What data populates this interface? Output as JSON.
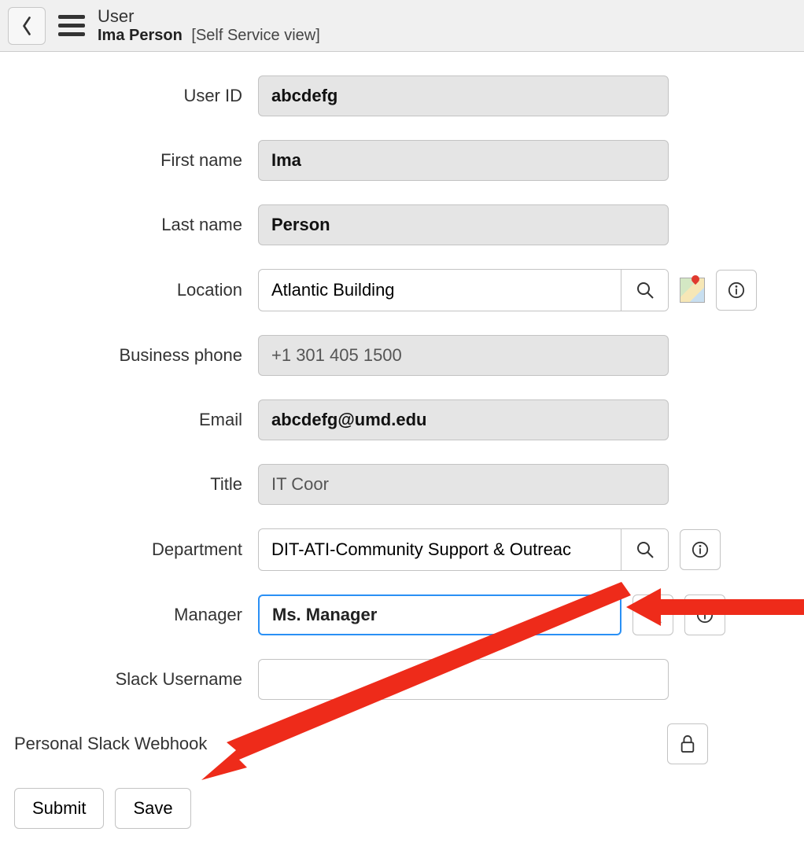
{
  "header": {
    "title": "User",
    "name": "Ima Person",
    "view_suffix": "[Self Service view]"
  },
  "fields": {
    "user_id": {
      "label": "User ID",
      "value": "abcdefg"
    },
    "first_name": {
      "label": "First name",
      "value": "Ima"
    },
    "last_name": {
      "label": "Last name",
      "value": "Person"
    },
    "location": {
      "label": "Location",
      "value": "Atlantic Building"
    },
    "business_phone": {
      "label": "Business phone",
      "value": "+1 301 405 1500"
    },
    "email": {
      "label": "Email",
      "value": "abcdefg@umd.edu"
    },
    "title": {
      "label": "Title",
      "value": "IT Coor"
    },
    "department": {
      "label": "Department",
      "value": "DIT-ATI-Community Support & Outreac"
    },
    "manager": {
      "label": "Manager",
      "value": "Ms. Manager"
    },
    "slack_username": {
      "label": "Slack Username",
      "value": ""
    },
    "slack_webhook": {
      "label": "Personal Slack Webhook"
    }
  },
  "buttons": {
    "submit": "Submit",
    "save": "Save"
  }
}
